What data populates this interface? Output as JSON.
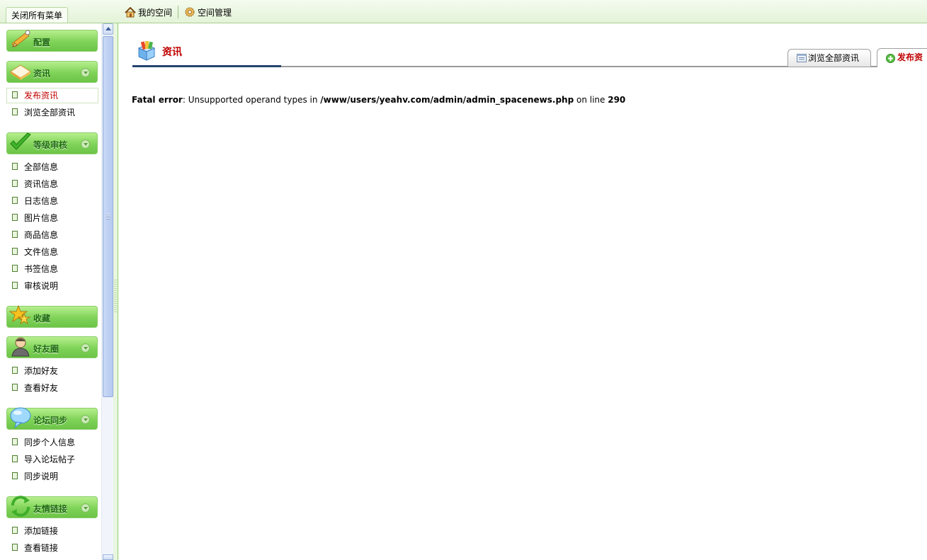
{
  "topbar": {
    "close_all_label": "关闭所有菜单",
    "nav": [
      {
        "label": "我的空间",
        "icon": "home-icon"
      },
      {
        "label": "空间管理",
        "icon": "gear-icon"
      }
    ]
  },
  "sidebar": {
    "groups": [
      {
        "label": "配置",
        "icon": "pencil-icon",
        "items": []
      },
      {
        "label": "资讯",
        "icon": "book-icon",
        "items": [
          "发布资讯",
          "浏览全部资讯"
        ]
      },
      {
        "label": "等级审核",
        "icon": "checkmark-icon",
        "items": [
          "全部信息",
          "资讯信息",
          "日志信息",
          "图片信息",
          "商品信息",
          "文件信息",
          "书签信息",
          "审核说明"
        ]
      },
      {
        "label": "收藏",
        "icon": "star-icon",
        "items": []
      },
      {
        "label": "好友圈",
        "icon": "user-icon",
        "items": [
          "添加好友",
          "查看好友"
        ]
      },
      {
        "label": "论坛同步",
        "icon": "speech-bubble-icon",
        "items": [
          "同步个人信息",
          "导入论坛帖子",
          "同步说明"
        ]
      },
      {
        "label": "友情链接",
        "icon": "refresh-icon",
        "items": [
          "添加链接",
          "查看链接"
        ]
      }
    ],
    "active_item": "发布资讯"
  },
  "main": {
    "title": "资讯",
    "tabs": [
      {
        "label": "浏览全部资讯",
        "icon": "list-icon"
      },
      {
        "label": "发布资",
        "icon": "plus-circle-icon"
      }
    ],
    "error": {
      "prefix": "Fatal error",
      "message": ": Unsupported operand types in ",
      "file": "/www/users/yeahv.com/admin/admin_spacenews.php",
      "line_prefix": " on line ",
      "line": "290"
    }
  }
}
